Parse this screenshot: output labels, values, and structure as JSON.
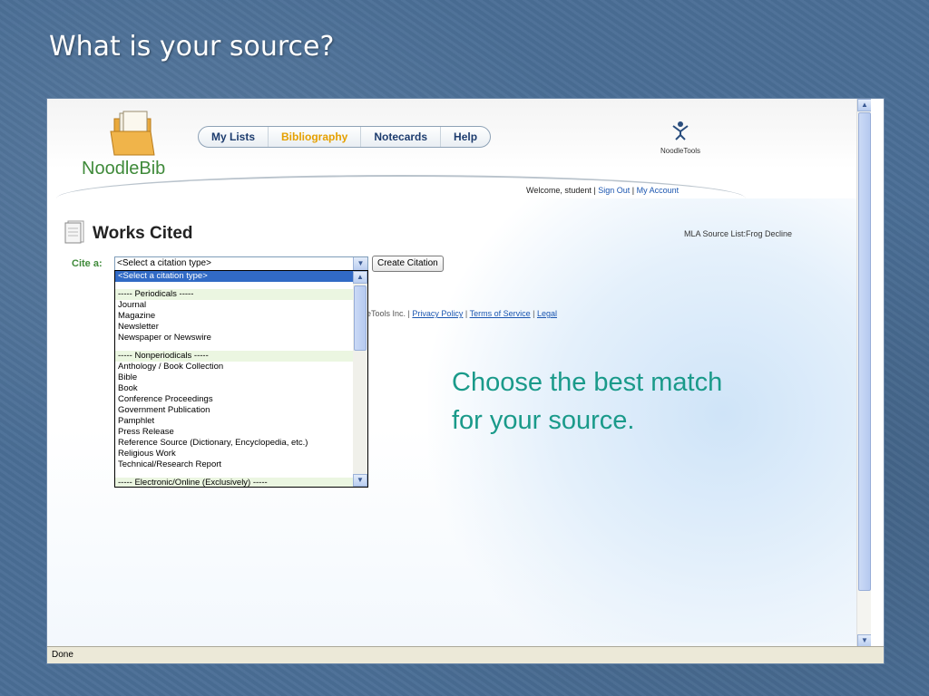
{
  "slide": {
    "title": "What is your source?",
    "callout": [
      "Choose the best match",
      "for your source."
    ]
  },
  "app": {
    "logo_text": "NoodleBib",
    "noodletools_label": "NoodleTools",
    "nav": [
      {
        "label": "My Lists",
        "active": false
      },
      {
        "label": "Bibliography",
        "active": true
      },
      {
        "label": "Notecards",
        "active": false
      },
      {
        "label": "Help",
        "active": false
      }
    ],
    "welcome_prefix": "Welcome, student |",
    "sign_out": "Sign Out",
    "separator": "|",
    "my_account": "My Account",
    "page_title": "Works Cited",
    "mla_label": "MLA Source List:",
    "mla_value": "Frog Decline",
    "cite_label": "Cite a:",
    "select_value": "<Select a citation type>",
    "create_button": "Create Citation",
    "footer_text": "dleTools Inc. |",
    "privacy": "Privacy Policy",
    "terms": "Terms of Service",
    "legal": "Legal",
    "status": "Done"
  },
  "dropdown": {
    "options": [
      {
        "label": "<Select a citation type>",
        "kind": "sel"
      },
      {
        "label": "",
        "kind": "blank"
      },
      {
        "label": "----- Periodicals -----",
        "kind": "head"
      },
      {
        "label": "Journal",
        "kind": "opt"
      },
      {
        "label": "Magazine",
        "kind": "opt"
      },
      {
        "label": "Newsletter",
        "kind": "opt"
      },
      {
        "label": "Newspaper or Newswire",
        "kind": "opt"
      },
      {
        "label": "",
        "kind": "blank"
      },
      {
        "label": "----- Nonperiodicals -----",
        "kind": "head"
      },
      {
        "label": "Anthology / Book Collection",
        "kind": "opt"
      },
      {
        "label": "Bible",
        "kind": "opt"
      },
      {
        "label": "Book",
        "kind": "opt"
      },
      {
        "label": "Conference Proceedings",
        "kind": "opt"
      },
      {
        "label": "Government Publication",
        "kind": "opt"
      },
      {
        "label": "Pamphlet",
        "kind": "opt"
      },
      {
        "label": "Press Release",
        "kind": "opt"
      },
      {
        "label": "Reference Source (Dictionary, Encyclopedia, etc.)",
        "kind": "opt"
      },
      {
        "label": "Religious Work",
        "kind": "opt"
      },
      {
        "label": "Technical/Research Report",
        "kind": "opt"
      },
      {
        "label": "",
        "kind": "blank"
      },
      {
        "label": "----- Electronic/Online (Exclusively) -----",
        "kind": "head"
      }
    ]
  },
  "colors": {
    "slide_bg": "#4a6e96",
    "callout": "#1a9a8a",
    "nav_active": "#e5a000",
    "logo_green": "#3f8a3a",
    "selection": "#316ac5"
  }
}
